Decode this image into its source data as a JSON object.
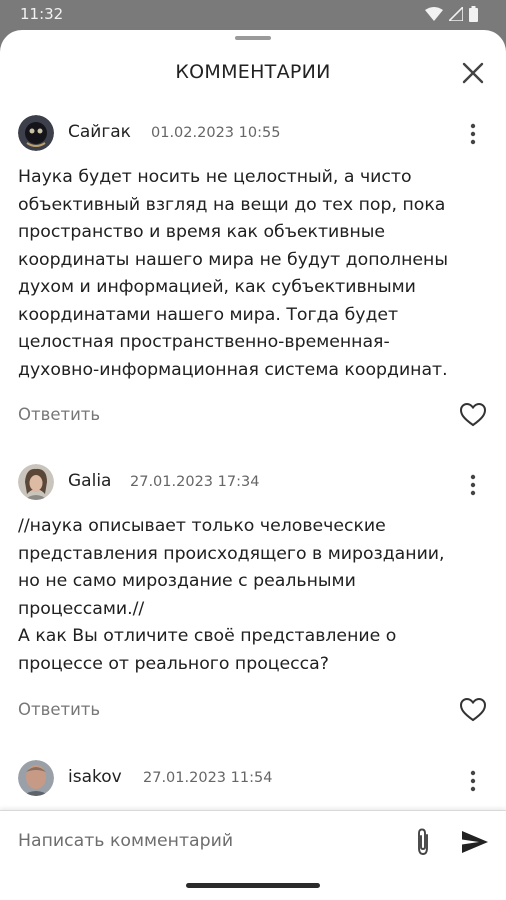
{
  "status_bar": {
    "time": "11:32",
    "icons": [
      "wifi-icon",
      "signal-icon",
      "battery-icon"
    ]
  },
  "sheet": {
    "title": "КОММЕНТАРИИ",
    "close_icon": "close-icon"
  },
  "comments": [
    {
      "author": "Сайгак",
      "date": "01.02.2023 10:55",
      "text": "Наука будет носить не целостный, а чисто\nобъективный взгляд на вещи до тех пор, пока\nпространство и время как объективные\nкоординаты нашего мира не будут дополнены\nдухом и информацией, как субъективными\nкоординатами нашего мира. Тогда будет\nцелостная пространственно-временная-\nдуховно-информационная система координат.",
      "reply_label": "Ответить"
    },
    {
      "author": "Galia",
      "date": "27.01.2023 17:34",
      "text": "//наука описывает только человеческие\nпредставления происходящего в мироздании,\nно не само мироздание с реальными\nпроцессами.//\nА как Вы отличите своё представление о\nпроцессе от реального процесса?",
      "reply_label": "Ответить"
    },
    {
      "author": "isakov",
      "date": "27.01.2023 11:54"
    }
  ],
  "composer": {
    "placeholder": "Написать комментарий",
    "attach_icon": "paperclip-icon",
    "send_icon": "send-icon"
  },
  "colors": {
    "overlay": "#7a7a7a",
    "sheet": "#ffffff",
    "text": "#202020",
    "muted": "#777777"
  }
}
